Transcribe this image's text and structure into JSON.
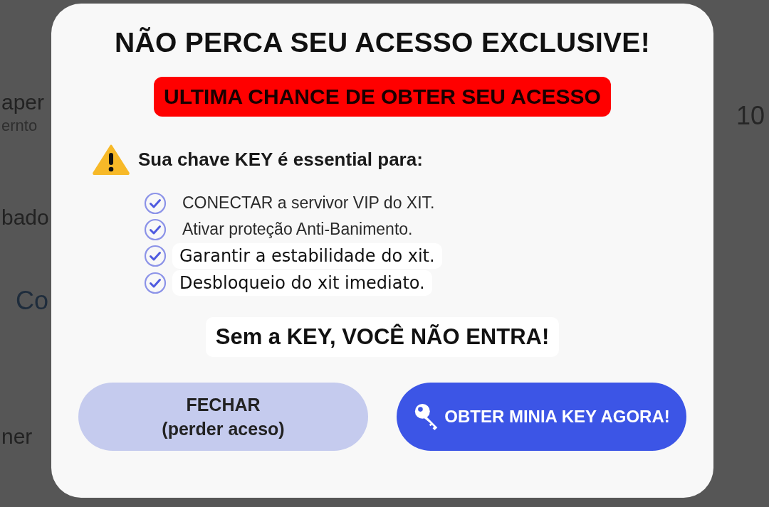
{
  "background": {
    "left": [
      {
        "text": "aper",
        "kind": "heading"
      },
      {
        "text": "ernto",
        "kind": "sub"
      },
      {
        "text": "bado",
        "kind": "heading"
      },
      {
        "text": "Co",
        "kind": "link"
      },
      {
        "text": "ner",
        "kind": "heading"
      }
    ],
    "right": [
      {
        "text": "10",
        "kind": "number"
      }
    ]
  },
  "dialog": {
    "title": "NÃO PERCA SEU ACESSO EXCLUSIVE!",
    "banner": "ULTIMA CHANCE DE OBTER SEU ACESSO",
    "warning": "Sua chave KEY é essential para:",
    "items": [
      {
        "text": "CONECTAR a servivor VIP do XIT.",
        "kind": "plain"
      },
      {
        "text": "Ativar proteção Anti-Banimento.",
        "kind": "plain"
      },
      {
        "text": "Garantir a estabilidade do xit.",
        "kind": "highlighted"
      },
      {
        "text": "Desbloqueio do xit imediato.",
        "kind": "highlighted"
      }
    ],
    "notice": "Sem a KEY, VOCÊ NÃO ENTRA!",
    "buttons": [
      {
        "kind": "secondary",
        "lines": [
          "FECHAR",
          "(perder aceso)"
        ]
      },
      {
        "kind": "primary",
        "lines": [
          "OBTER MINIA KEY AGORA!"
        ]
      }
    ]
  }
}
